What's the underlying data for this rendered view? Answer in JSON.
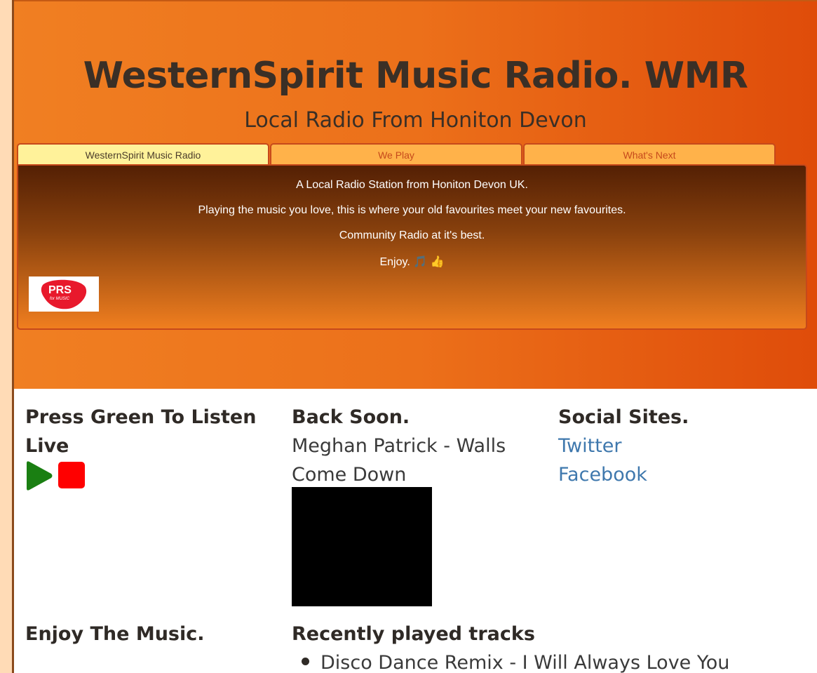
{
  "header": {
    "title": "WesternSpirit Music Radio. WMR",
    "subtitle": "Local Radio From Honiton Devon"
  },
  "tabs": [
    {
      "label": "WesternSpirit Music Radio",
      "active": true
    },
    {
      "label": "We Play",
      "active": false
    },
    {
      "label": "What's Next",
      "active": false
    }
  ],
  "panel": {
    "lines": [
      "A Local Radio Station from Honiton Devon UK.",
      "Playing the music you love, this is where your old favourites meet your new favourites.",
      "Community Radio at it's best.",
      "Enjoy. 🎵 👍"
    ],
    "logo_text": "PRS",
    "logo_subtext": "for MUSIC"
  },
  "listen": {
    "heading": "Press Green To Listen Live",
    "play_color": "#1a7f12",
    "stop_color": "#ff0000"
  },
  "now_playing": {
    "heading": "Back Soon.",
    "track": "Meghan Patrick - Walls Come Down"
  },
  "social": {
    "heading": "Social Sites.",
    "links": [
      "Twitter",
      "Facebook"
    ]
  },
  "enjoy": {
    "heading": "Enjoy The Music."
  },
  "recent": {
    "heading": "Recently played tracks",
    "tracks": [
      "Disco Dance Remix - I Will Always Love You"
    ]
  },
  "colors": {
    "hero_start": "#f07f22",
    "hero_end": "#df4c0a",
    "link": "#3f78ad",
    "tab_active": "#fff29a",
    "tab_inactive": "#ffb24a"
  }
}
